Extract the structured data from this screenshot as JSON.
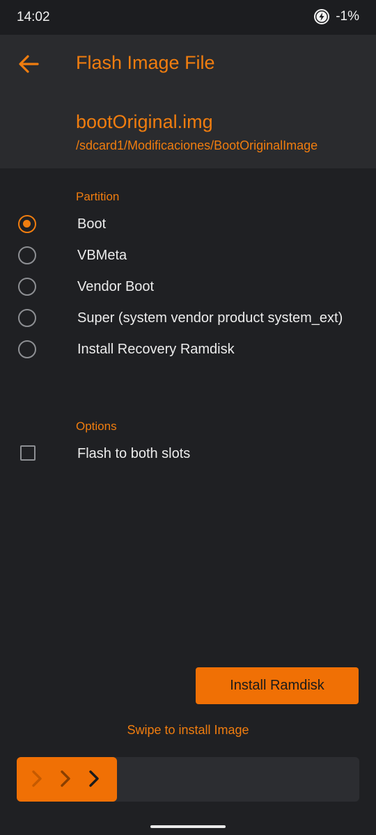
{
  "status_bar": {
    "time": "14:02",
    "battery_icon": "battery-charging-icon",
    "battery_text": "-1%"
  },
  "header": {
    "back_icon": "arrow-left-icon",
    "title": "Flash Image File",
    "file_name": "bootOriginal.img",
    "file_path": "/sdcard1/Modificaciones/BootOriginalImage"
  },
  "partition": {
    "label": "Partition",
    "options": [
      {
        "label": "Boot",
        "selected": true
      },
      {
        "label": "VBMeta",
        "selected": false
      },
      {
        "label": "Vendor Boot",
        "selected": false
      },
      {
        "label": "Super (system vendor product system_ext)",
        "selected": false
      },
      {
        "label": "Install Recovery Ramdisk",
        "selected": false
      }
    ]
  },
  "options": {
    "label": "Options",
    "flash_both_slots": {
      "label": "Flash to both slots",
      "checked": false
    }
  },
  "actions": {
    "install_ramdisk": "Install Ramdisk",
    "swipe_label": "Swipe to install Image"
  },
  "colors": {
    "accent": "#f07d0f",
    "background": "#1f2023",
    "header_bg": "#2a2b2e"
  }
}
